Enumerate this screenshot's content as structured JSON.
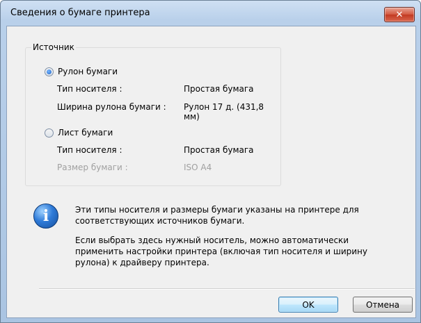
{
  "window": {
    "title": "Сведения о бумаге принтера",
    "close_glyph": "✕"
  },
  "source_group": {
    "legend": "Источник",
    "roll": {
      "label": "Рулон бумаги",
      "selected": true,
      "media_type_label": "Тип носителя :",
      "media_type_value": "Простая бумага",
      "roll_width_label": "Ширина рулона бумаги :",
      "roll_width_value": "Рулон 17 д. (431,8 мм)"
    },
    "sheet": {
      "label": "Лист бумаги",
      "selected": false,
      "media_type_label": "Тип носителя :",
      "media_type_value": "Простая бумага",
      "paper_size_label": "Размер бумаги :",
      "paper_size_value": "ISO A4"
    }
  },
  "info": {
    "icon": "info-icon",
    "line1": "Эти типы носителя и размеры бумаги указаны на принтере для",
    "line2": "соответствующих источников бумаги.",
    "line3": "Если выбрать здесь нужный носитель, можно автоматически",
    "line4": "применить настройки принтера (включая тип носителя и ширину",
    "line5": "рулона) к драйверу принтера."
  },
  "buttons": {
    "ok": "OK",
    "cancel": "Отмена"
  },
  "colors": {
    "frame": "#b9d0ea",
    "client": "#f0f0f0",
    "close_button": "#c23a22",
    "disabled_text": "#a0a0a0"
  }
}
